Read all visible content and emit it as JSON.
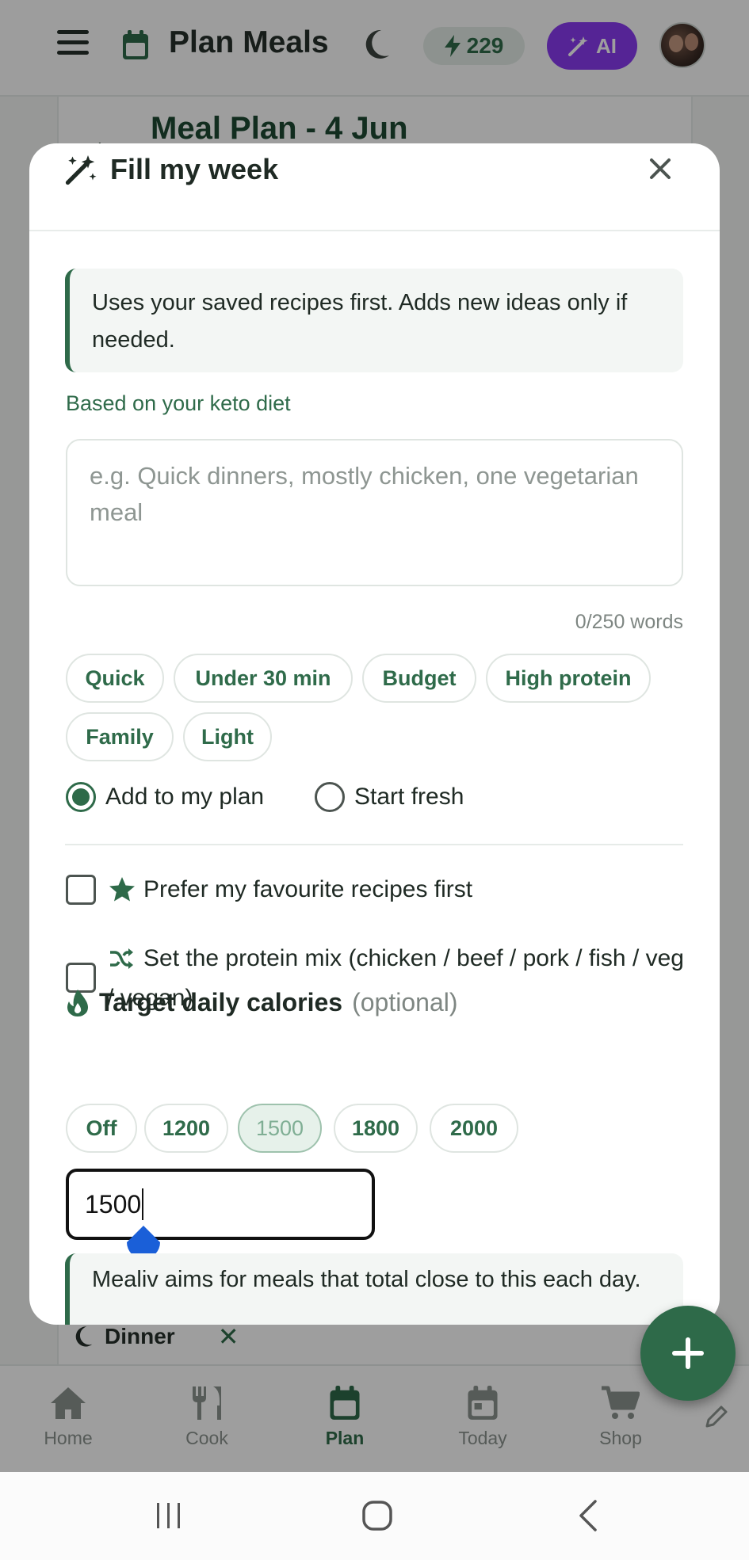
{
  "app": {
    "title": "Plan Meals",
    "credits": "229",
    "ai_label": "AI",
    "plan_title": "Meal Plan - 4 Jun",
    "dinner_label": "Dinner",
    "accent_color": "#2e6a49",
    "ai_color": "#8a3bf0"
  },
  "nav": {
    "items": [
      {
        "label": "Home",
        "icon": "home-icon"
      },
      {
        "label": "Cook",
        "icon": "utensils-icon"
      },
      {
        "label": "Plan",
        "icon": "calendar-icon",
        "active": true
      },
      {
        "label": "Today",
        "icon": "calendar-day-icon"
      },
      {
        "label": "Shop",
        "icon": "cart-icon"
      }
    ]
  },
  "modal": {
    "title": "Fill my week",
    "info": "Uses your saved recipes first. Adds new ideas only if needed.",
    "diet_label": "Based on your keto diet",
    "prompt_placeholder": "e.g. Quick dinners, mostly chicken, one vegetarian meal",
    "prompt_value": "",
    "word_count": "0/250 words",
    "chips": [
      "Quick",
      "Under 30 min",
      "Budget",
      "High protein",
      "Family",
      "Light"
    ],
    "mode_options": [
      {
        "label": "Add to my plan",
        "selected": true
      },
      {
        "label": "Start fresh",
        "selected": false
      }
    ],
    "favourites_label": "Prefer my favourite recipes first",
    "protein_mix_label": "Set the protein mix (chicken / beef / pork / fish / veg / vegan)",
    "calories_heading": "Target daily calories",
    "calories_optional": "(optional)",
    "calorie_options": [
      "Off",
      "1200",
      "1500",
      "1800",
      "2000"
    ],
    "calorie_selected": "1500",
    "calorie_value": "1500",
    "calorie_info": "Mealiv aims for meals that total close to this each day."
  }
}
